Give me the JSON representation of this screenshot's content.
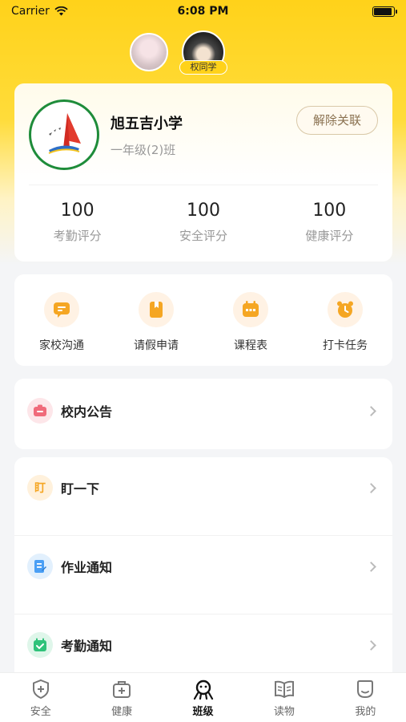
{
  "status_bar": {
    "carrier": "Carrier",
    "time": "6:08 PM"
  },
  "children": [
    {
      "tag": ""
    },
    {
      "tag": "权同学"
    }
  ],
  "school": {
    "name": "旭五吉小学",
    "class_name": "一年级(2)班",
    "unlink_label": "解除关联"
  },
  "scores": [
    {
      "value": "100",
      "label": "考勤评分"
    },
    {
      "value": "100",
      "label": "安全评分"
    },
    {
      "value": "100",
      "label": "健康评分"
    }
  ],
  "quick_actions": [
    {
      "label": "家校沟通",
      "icon": "chat-icon"
    },
    {
      "label": "请假申请",
      "icon": "leave-icon"
    },
    {
      "label": "课程表",
      "icon": "calendar-icon"
    },
    {
      "label": "打卡任务",
      "icon": "alarm-clock-icon"
    }
  ],
  "list_items": [
    {
      "label": "校内公告",
      "icon": "announcement-icon",
      "color": "#f06a7a"
    },
    {
      "label": "盯一下",
      "icon_text": "盯",
      "icon": "watch-icon",
      "color": "#f5a623"
    },
    {
      "label": "作业通知",
      "icon": "homework-icon",
      "color": "#4a9ff5"
    },
    {
      "label": "考勤通知",
      "icon": "attendance-icon",
      "color": "#2fc27a"
    }
  ],
  "tabs": [
    {
      "label": "安全",
      "icon": "shield-icon"
    },
    {
      "label": "健康",
      "icon": "medkit-icon"
    },
    {
      "label": "班级",
      "icon": "class-icon",
      "active": true
    },
    {
      "label": "读物",
      "icon": "book-icon"
    },
    {
      "label": "我的",
      "icon": "profile-icon"
    }
  ],
  "colors": {
    "brand_yellow": "#ffd21a",
    "accent_orange": "#f5a623"
  }
}
